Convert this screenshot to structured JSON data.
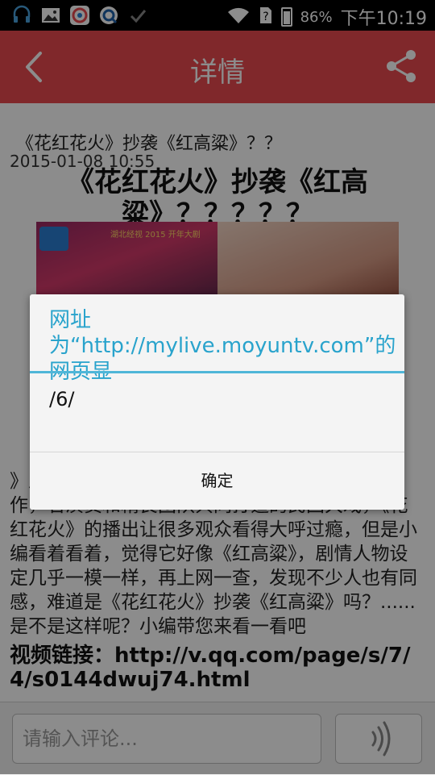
{
  "status_bar": {
    "icons": [
      "headset-icon",
      "image-icon",
      "app-icon",
      "browser-icon",
      "check-icon"
    ],
    "battery": "86%",
    "time": "下午10:19"
  },
  "app_bar": {
    "title": "详情",
    "back_icon": "chevron-left-icon",
    "share_icon": "share-icon",
    "color": "#e94a4f"
  },
  "article": {
    "small_title": "《花红花火》抄袭《红高粱》？？",
    "date": "2015-01-08 10:55",
    "big_title": "《花红花火》抄袭《红高粱》？？？？？",
    "image_banner": "湖北经视 2015 开年大剧",
    "body": "》正在热播的优秀当代剧集花红花火》作为大制作，名演员和精良团队共同打造的民国大戏，《花红花火》的播出让很多观众看得大呼过瘾，但是小编看着看着，觉得它好像《红高粱》，剧情人物设定几乎一模一样，再上网一查，发现不少人也有同感，难道是《花红花火》抄袭《红高粱》吗？......是不是这样呢？小编带您来看一看吧",
    "link": "视频链接：http://v.qq.com/page/s/7/4/s0144dwuj74.html"
  },
  "footer": {
    "comment_placeholder": "请输入评论...",
    "voice_icon": "voice-icon"
  },
  "dialog": {
    "title": "网址为“http://mylive.moyuntv.com”的网页显",
    "message": "/6/",
    "ok_label": "确定",
    "accent": "#29a3cc"
  }
}
